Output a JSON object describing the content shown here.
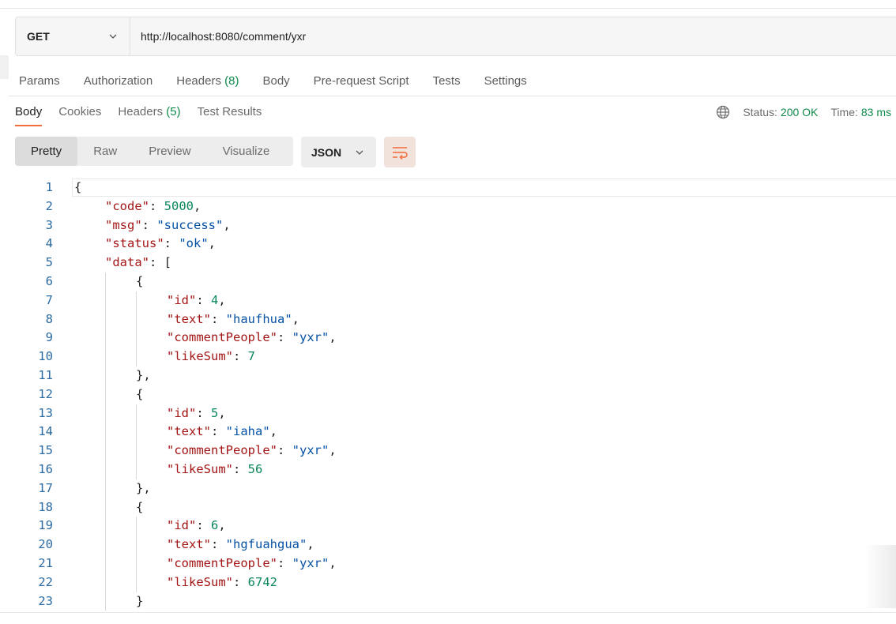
{
  "request": {
    "method": "GET",
    "url": "http://localhost:8080/comment/yxr"
  },
  "request_tabs": [
    {
      "label": "Params",
      "count": ""
    },
    {
      "label": "Authorization",
      "count": ""
    },
    {
      "label": "Headers",
      "count": "(8)"
    },
    {
      "label": "Body",
      "count": ""
    },
    {
      "label": "Pre-request Script",
      "count": ""
    },
    {
      "label": "Tests",
      "count": ""
    },
    {
      "label": "Settings",
      "count": ""
    }
  ],
  "response_tabs": [
    {
      "label": "Body",
      "count": "",
      "active": true
    },
    {
      "label": "Cookies",
      "count": ""
    },
    {
      "label": "Headers",
      "count": "(5)"
    },
    {
      "label": "Test Results",
      "count": ""
    }
  ],
  "status": {
    "status_label": "Status:",
    "status_value": "200 OK",
    "time_label": "Time:",
    "time_value": "83 ms"
  },
  "format_buttons": [
    "Pretty",
    "Raw",
    "Preview",
    "Visualize"
  ],
  "language": "JSON",
  "colors": {
    "accent": "#f26b3a",
    "success": "#0f8a4a",
    "json_key": "#a31515",
    "json_string": "#0451a5",
    "json_number": "#098658",
    "line_number": "#2b6aa0"
  },
  "icons": {
    "method_dropdown": "chevron-down-icon",
    "globe": "globe-icon",
    "language_dropdown": "chevron-down-icon",
    "wrap": "wrap-lines-icon"
  },
  "code_lines": [
    {
      "n": "1",
      "indent": 0,
      "tokens": [
        [
          "p",
          "{"
        ]
      ]
    },
    {
      "n": "2",
      "indent": 1,
      "tokens": [
        [
          "k",
          "\"code\""
        ],
        [
          "p",
          ": "
        ],
        [
          "n",
          "5000"
        ],
        [
          "p",
          ","
        ]
      ]
    },
    {
      "n": "3",
      "indent": 1,
      "tokens": [
        [
          "k",
          "\"msg\""
        ],
        [
          "p",
          ": "
        ],
        [
          "s",
          "\"success\""
        ],
        [
          "p",
          ","
        ]
      ]
    },
    {
      "n": "4",
      "indent": 1,
      "tokens": [
        [
          "k",
          "\"status\""
        ],
        [
          "p",
          ": "
        ],
        [
          "s",
          "\"ok\""
        ],
        [
          "p",
          ","
        ]
      ]
    },
    {
      "n": "5",
      "indent": 1,
      "tokens": [
        [
          "k",
          "\"data\""
        ],
        [
          "p",
          ": ["
        ]
      ]
    },
    {
      "n": "6",
      "indent": 2,
      "tokens": [
        [
          "p",
          "{"
        ]
      ]
    },
    {
      "n": "7",
      "indent": 3,
      "tokens": [
        [
          "k",
          "\"id\""
        ],
        [
          "p",
          ": "
        ],
        [
          "n",
          "4"
        ],
        [
          "p",
          ","
        ]
      ]
    },
    {
      "n": "8",
      "indent": 3,
      "tokens": [
        [
          "k",
          "\"text\""
        ],
        [
          "p",
          ": "
        ],
        [
          "s",
          "\"haufhua\""
        ],
        [
          "p",
          ","
        ]
      ]
    },
    {
      "n": "9",
      "indent": 3,
      "tokens": [
        [
          "k",
          "\"commentPeople\""
        ],
        [
          "p",
          ": "
        ],
        [
          "s",
          "\"yxr\""
        ],
        [
          "p",
          ","
        ]
      ]
    },
    {
      "n": "10",
      "indent": 3,
      "tokens": [
        [
          "k",
          "\"likeSum\""
        ],
        [
          "p",
          ": "
        ],
        [
          "n",
          "7"
        ]
      ]
    },
    {
      "n": "11",
      "indent": 2,
      "tokens": [
        [
          "p",
          "},"
        ]
      ]
    },
    {
      "n": "12",
      "indent": 2,
      "tokens": [
        [
          "p",
          "{"
        ]
      ]
    },
    {
      "n": "13",
      "indent": 3,
      "tokens": [
        [
          "k",
          "\"id\""
        ],
        [
          "p",
          ": "
        ],
        [
          "n",
          "5"
        ],
        [
          "p",
          ","
        ]
      ]
    },
    {
      "n": "14",
      "indent": 3,
      "tokens": [
        [
          "k",
          "\"text\""
        ],
        [
          "p",
          ": "
        ],
        [
          "s",
          "\"iaha\""
        ],
        [
          "p",
          ","
        ]
      ]
    },
    {
      "n": "15",
      "indent": 3,
      "tokens": [
        [
          "k",
          "\"commentPeople\""
        ],
        [
          "p",
          ": "
        ],
        [
          "s",
          "\"yxr\""
        ],
        [
          "p",
          ","
        ]
      ]
    },
    {
      "n": "16",
      "indent": 3,
      "tokens": [
        [
          "k",
          "\"likeSum\""
        ],
        [
          "p",
          ": "
        ],
        [
          "n",
          "56"
        ]
      ]
    },
    {
      "n": "17",
      "indent": 2,
      "tokens": [
        [
          "p",
          "},"
        ]
      ]
    },
    {
      "n": "18",
      "indent": 2,
      "tokens": [
        [
          "p",
          "{"
        ]
      ]
    },
    {
      "n": "19",
      "indent": 3,
      "tokens": [
        [
          "k",
          "\"id\""
        ],
        [
          "p",
          ": "
        ],
        [
          "n",
          "6"
        ],
        [
          "p",
          ","
        ]
      ]
    },
    {
      "n": "20",
      "indent": 3,
      "tokens": [
        [
          "k",
          "\"text\""
        ],
        [
          "p",
          ": "
        ],
        [
          "s",
          "\"hgfuahgua\""
        ],
        [
          "p",
          ","
        ]
      ]
    },
    {
      "n": "21",
      "indent": 3,
      "tokens": [
        [
          "k",
          "\"commentPeople\""
        ],
        [
          "p",
          ": "
        ],
        [
          "s",
          "\"yxr\""
        ],
        [
          "p",
          ","
        ]
      ]
    },
    {
      "n": "22",
      "indent": 3,
      "tokens": [
        [
          "k",
          "\"likeSum\""
        ],
        [
          "p",
          ": "
        ],
        [
          "n",
          "6742"
        ]
      ]
    },
    {
      "n": "23",
      "indent": 2,
      "tokens": [
        [
          "p",
          "}"
        ]
      ]
    }
  ]
}
